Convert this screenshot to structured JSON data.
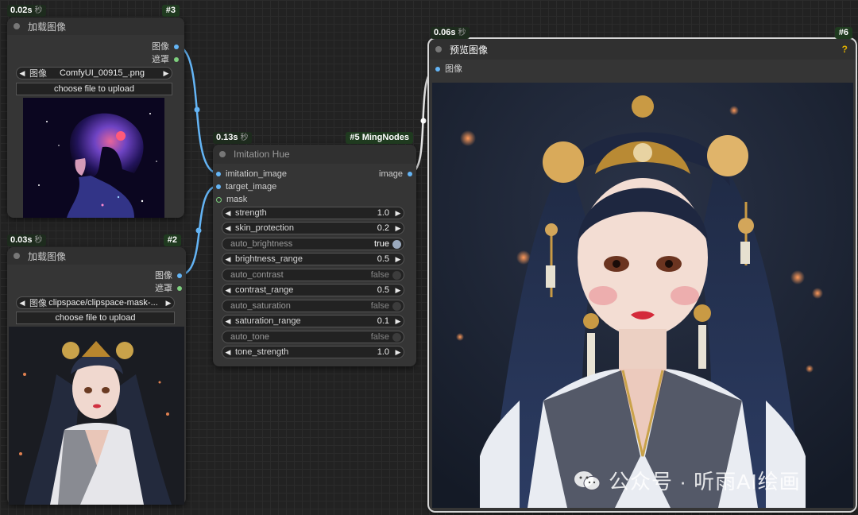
{
  "node3": {
    "time": "0.02s",
    "time_unit": "秒",
    "id": "#3",
    "title": "加载图像",
    "outputs": [
      "图像",
      "遮罩"
    ],
    "combo_label": "图像",
    "combo_value": "ComfyUI_00915_.png",
    "upload_label": "choose file to upload"
  },
  "node2": {
    "time": "0.03s",
    "time_unit": "秒",
    "id": "#2",
    "title": "加载图像",
    "outputs": [
      "图像",
      "遮罩"
    ],
    "combo_label": "图像",
    "combo_value": "clipspace/clipspace-mask-...",
    "upload_label": "choose file to upload"
  },
  "node5": {
    "time": "0.13s",
    "time_unit": "秒",
    "id": "#5 MingNodes",
    "title": "Imitation Hue",
    "inputs": [
      "imitation_image",
      "target_image",
      "mask"
    ],
    "output": "image",
    "widgets": [
      {
        "label": "strength",
        "value": "1.0",
        "kind": "number"
      },
      {
        "label": "skin_protection",
        "value": "0.2",
        "kind": "number"
      },
      {
        "label": "auto_brightness",
        "value": "true",
        "kind": "toggle"
      },
      {
        "label": "brightness_range",
        "value": "0.5",
        "kind": "number"
      },
      {
        "label": "auto_contrast",
        "value": "false",
        "kind": "toggle"
      },
      {
        "label": "contrast_range",
        "value": "0.5",
        "kind": "number"
      },
      {
        "label": "auto_saturation",
        "value": "false",
        "kind": "toggle"
      },
      {
        "label": "saturation_range",
        "value": "0.1",
        "kind": "number"
      },
      {
        "label": "auto_tone",
        "value": "false",
        "kind": "toggle"
      },
      {
        "label": "tone_strength",
        "value": "1.0",
        "kind": "number"
      }
    ]
  },
  "node6": {
    "time": "0.06s",
    "time_unit": "秒",
    "id": "#6",
    "title": "预览图像",
    "help": "?",
    "input": "图像"
  },
  "watermark": {
    "text": "公众号 · 听雨AI绘画"
  },
  "colors": {
    "image_link": "#64b5f6",
    "mask_slot": "#7ed07e",
    "canvas": "#222222",
    "node_body": "#353535",
    "help": "#e0b000"
  }
}
